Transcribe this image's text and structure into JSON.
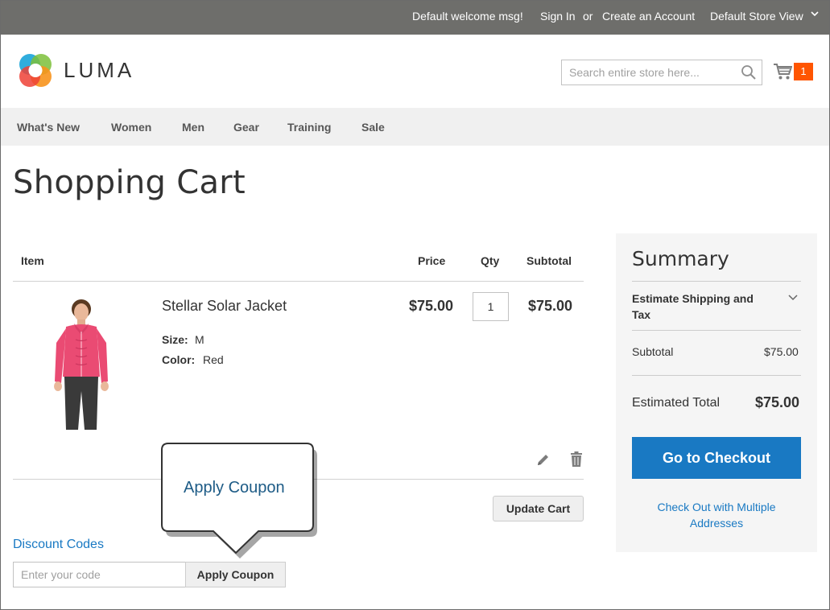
{
  "topbar": {
    "welcome": "Default welcome msg!",
    "sign_in": "Sign In",
    "or": "or",
    "create_account": "Create an Account",
    "store_view": "Default Store View"
  },
  "header": {
    "logo_text": "LUMA",
    "search_placeholder": "Search entire store here...",
    "cart_count": "1"
  },
  "nav": {
    "items": [
      "What's New",
      "Women",
      "Men",
      "Gear",
      "Training",
      "Sale"
    ]
  },
  "page_title": "Shopping Cart",
  "cart": {
    "columns": {
      "item": "Item",
      "price": "Price",
      "qty": "Qty",
      "subtotal": "Subtotal"
    },
    "items": [
      {
        "name": "Stellar Solar Jacket",
        "size_label": "Size:",
        "size_value": "M",
        "color_label": "Color:",
        "color_value": "Red",
        "price": "$75.00",
        "qty": "1",
        "subtotal": "$75.00"
      }
    ],
    "update_button": "Update Cart"
  },
  "discount": {
    "title": "Discount Codes",
    "placeholder": "Enter your code",
    "apply_button": "Apply Coupon"
  },
  "callout": {
    "text": "Apply Coupon"
  },
  "summary": {
    "title": "Summary",
    "estimate_shipping": "Estimate Shipping and Tax",
    "subtotal_label": "Subtotal",
    "subtotal_value": "$75.00",
    "total_label": "Estimated Total",
    "total_value": "$75.00",
    "checkout_button": "Go to Checkout",
    "multiple_addresses_link": "Check Out with Multiple Addresses"
  },
  "colors": {
    "topbar": "#6e6e6b",
    "accent": "#1979c3",
    "cart_badge": "#ff5501",
    "nav_bg": "#f0f0f0",
    "summary_bg": "#f5f5f5"
  }
}
